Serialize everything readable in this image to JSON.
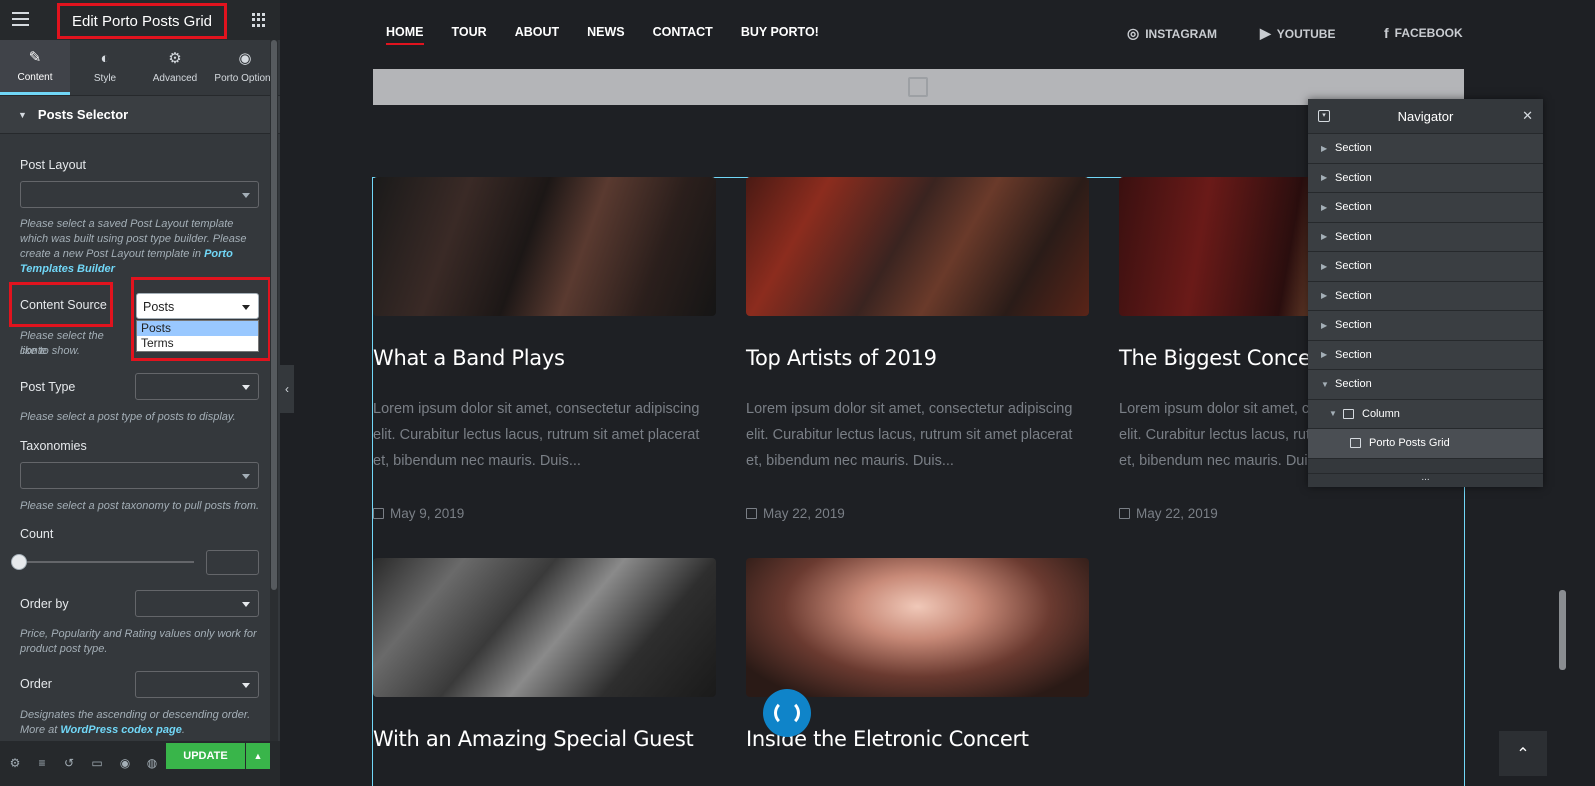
{
  "panel": {
    "title": "Edit Porto Posts Grid",
    "tabs": [
      {
        "label": "Content",
        "icon": "pencil-icon",
        "glyph": "✎"
      },
      {
        "label": "Style",
        "icon": "half-circle-icon",
        "glyph": "◐"
      },
      {
        "label": "Advanced",
        "icon": "gear-icon",
        "glyph": "⚙"
      },
      {
        "label": "Porto Options",
        "icon": "porto-icon",
        "glyph": "◉"
      }
    ],
    "section": "Posts Selector",
    "post_layout": {
      "label": "Post Layout",
      "desc": "Please select a saved Post Layout template which was built using post type builder. Please create a new Post Layout template in ",
      "link": "Porto Templates Builder"
    },
    "content_source": {
      "label": "Content Source",
      "value": "Posts",
      "options": [
        "Posts",
        "Terms"
      ],
      "desc_a": "Please select the conte",
      "desc_b": "like to show."
    },
    "post_type": {
      "label": "Post Type",
      "desc": "Please select a post type of posts to display."
    },
    "taxonomies": {
      "label": "Taxonomies",
      "desc": "Please select a post taxonomy to pull posts from."
    },
    "count": {
      "label": "Count",
      "value": ""
    },
    "order_by": {
      "label": "Order by",
      "desc": "Price, Popularity and Rating values only work for product post type."
    },
    "order": {
      "label": "Order",
      "desc_a": "Designates the ascending or descending order.",
      "desc_b": "More at ",
      "link": "WordPress codex page",
      "desc_c": "."
    },
    "update_label": "UPDATE"
  },
  "site_nav": {
    "links": [
      "HOME",
      "TOUR",
      "ABOUT",
      "NEWS",
      "CONTACT",
      "BUY PORTO!"
    ],
    "social": [
      {
        "label": "INSTAGRAM",
        "icon": "instagram-icon",
        "glyph": "◎"
      },
      {
        "label": "YOUTUBE",
        "icon": "youtube-icon",
        "glyph": "▶"
      },
      {
        "label": "FACEBOOK",
        "icon": "facebook-icon",
        "glyph": "f"
      }
    ]
  },
  "posts": [
    {
      "title": "What a Band Plays",
      "excerpt": "Lorem ipsum dolor sit amet, consectetur adipiscing elit. Curabitur lectus lacus, rutrum sit amet placerat et, bibendum nec mauris. Duis...",
      "date": "May 9, 2019"
    },
    {
      "title": "Top Artists of 2019",
      "excerpt": "Lorem ipsum dolor sit amet, consectetur adipiscing elit. Curabitur lectus lacus, rutrum sit amet placerat et, bibendum nec mauris. Duis...",
      "date": "May 22, 2019"
    },
    {
      "title": "The Biggest Concer",
      "excerpt": "Lorem ipsum dolor sit amet, consectetur adipiscing elit. Curabitur lectus lacus, rutrum sit amet placerat et, bibendum nec mauris. Duis...",
      "date": "May 22, 2019"
    },
    {
      "title": "With an Amazing Special Guest"
    },
    {
      "title": "Inside the Eletronic Concert"
    }
  ],
  "navigator": {
    "title": "Navigator",
    "sections": [
      "Section",
      "Section",
      "Section",
      "Section",
      "Section",
      "Section",
      "Section",
      "Section",
      "Section"
    ],
    "column": "Column",
    "widget": "Porto Posts Grid",
    "more": "..."
  },
  "colors": {
    "accent": "#71d7f7",
    "highlight": "#e1131e",
    "update": "#39b54a",
    "panel_bg": "#34383c",
    "page_bg": "#1e2024"
  }
}
